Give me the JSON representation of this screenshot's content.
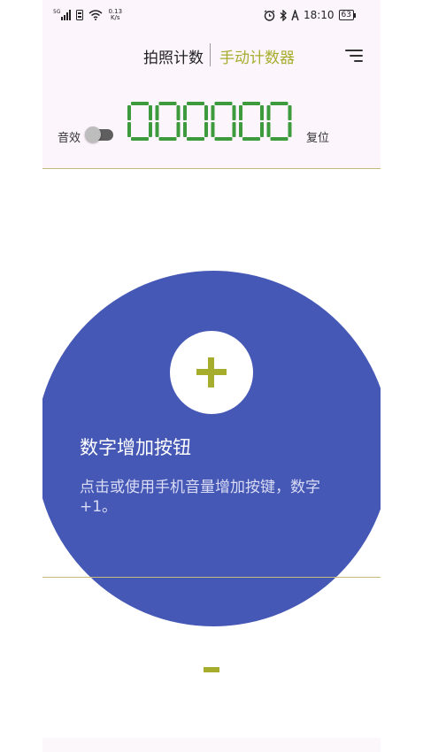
{
  "status_bar": {
    "network": "5G",
    "net_speed_value": "0.13",
    "net_speed_unit": "K/s",
    "time": "18:10",
    "battery": "63"
  },
  "tabs": [
    {
      "label": "拍照计数",
      "active": false
    },
    {
      "label": "手动计数器",
      "active": true
    }
  ],
  "controls": {
    "sound_label": "音效",
    "sound_on": false,
    "reset_label": "复位"
  },
  "counter": {
    "value": "000000",
    "color": "#3d9a3d"
  },
  "increment": {
    "title": "数字增加按钮",
    "description": "点击或使用手机音量增加按键，数字 +1。",
    "circle_color": "#4658b6"
  },
  "colors": {
    "accent": "#a6ad2c",
    "header_bg": "#fcf5fc"
  },
  "icons": {
    "menu": "menu-icon",
    "plus": "plus-icon",
    "minus": "minus-icon"
  }
}
